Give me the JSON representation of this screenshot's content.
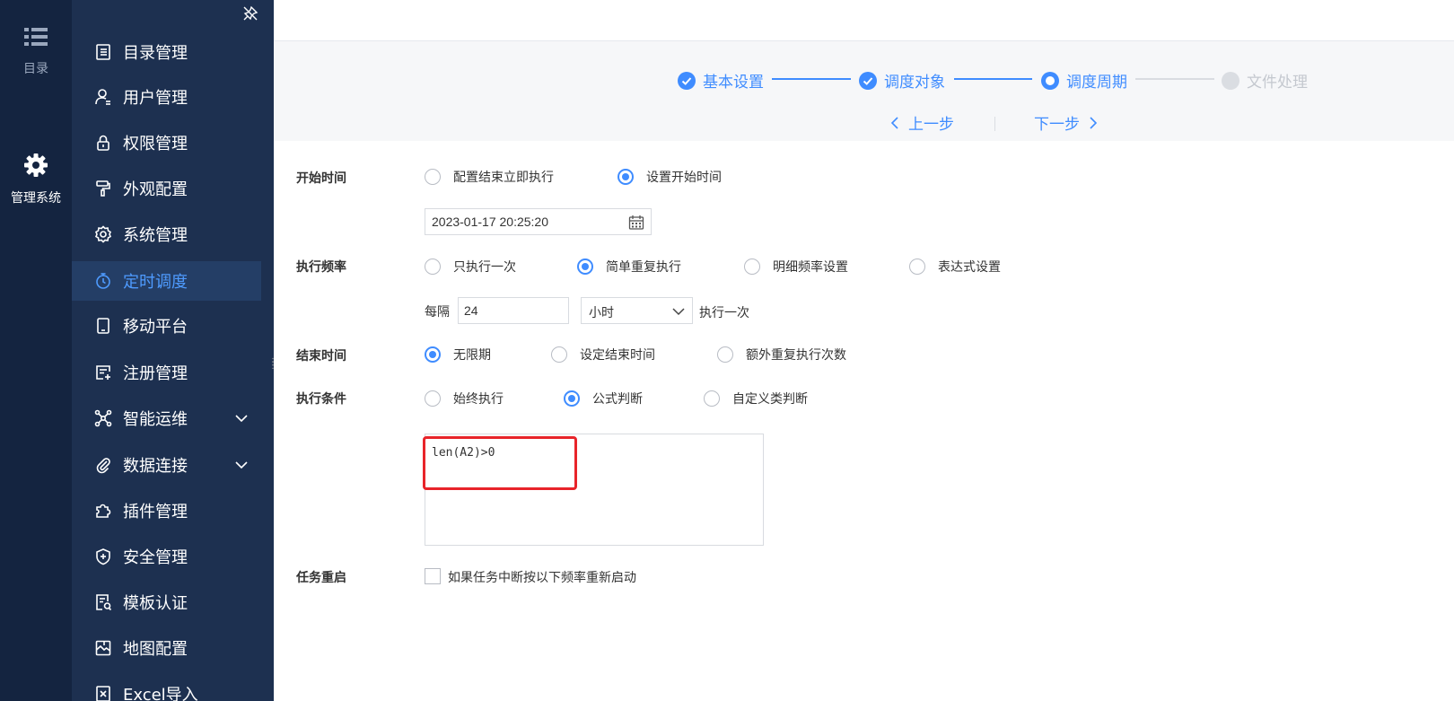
{
  "rail": {
    "items": [
      {
        "label": "目录",
        "icon": "list-icon"
      },
      {
        "label": "管理系统",
        "icon": "gear-icon"
      }
    ]
  },
  "sidebar": {
    "items": [
      {
        "label": "目录管理",
        "icon": "catalog-icon"
      },
      {
        "label": "用户管理",
        "icon": "user-icon"
      },
      {
        "label": "权限管理",
        "icon": "lock-icon"
      },
      {
        "label": "外观配置",
        "icon": "paint-roller-icon"
      },
      {
        "label": "系统管理",
        "icon": "settings-icon"
      },
      {
        "label": "定时调度",
        "icon": "timer-icon",
        "active": true
      },
      {
        "label": "移动平台",
        "icon": "tablet-icon"
      },
      {
        "label": "注册管理",
        "icon": "register-icon"
      },
      {
        "label": "智能运维",
        "icon": "network-icon",
        "expandable": true
      },
      {
        "label": "数据连接",
        "icon": "paperclip-icon",
        "expandable": true
      },
      {
        "label": "插件管理",
        "icon": "puzzle-icon"
      },
      {
        "label": "安全管理",
        "icon": "shield-icon"
      },
      {
        "label": "模板认证",
        "icon": "template-cert-icon"
      },
      {
        "label": "地图配置",
        "icon": "map-icon"
      },
      {
        "label": "Excel导入",
        "icon": "excel-icon"
      }
    ]
  },
  "steps": {
    "items": [
      {
        "label": "基本设置",
        "state": "done"
      },
      {
        "label": "调度对象",
        "state": "done"
      },
      {
        "label": "调度周期",
        "state": "current"
      },
      {
        "label": "文件处理",
        "state": "pending"
      }
    ],
    "prev": "上一步",
    "next": "下一步"
  },
  "form": {
    "start_time": {
      "label": "开始时间",
      "options": [
        "配置结束立即执行",
        "设置开始时间"
      ],
      "selected": 1,
      "datetime": "2023-01-17 20:25:20"
    },
    "frequency": {
      "label": "执行频率",
      "options": [
        "只执行一次",
        "简单重复执行",
        "明细频率设置",
        "表达式设置"
      ],
      "selected": 1,
      "every_label": "每隔",
      "interval_value": "24",
      "unit": "小时",
      "suffix": "执行一次"
    },
    "end_time": {
      "label": "结束时间",
      "options": [
        "无限期",
        "设定结束时间",
        "额外重复执行次数"
      ],
      "selected": 0
    },
    "condition": {
      "label": "执行条件",
      "options": [
        "始终执行",
        "公式判断",
        "自定义类判断"
      ],
      "selected": 1,
      "formula": "len(A2)>0"
    },
    "restart": {
      "label": "任务重启",
      "checkbox_label": "如果任务中断按以下频率重新启动",
      "checked": false
    }
  },
  "colors": {
    "accent": "#3f8cff",
    "rail_bg": "#142440",
    "sidebar_bg": "#1d3050",
    "highlight": "#e8242a"
  }
}
